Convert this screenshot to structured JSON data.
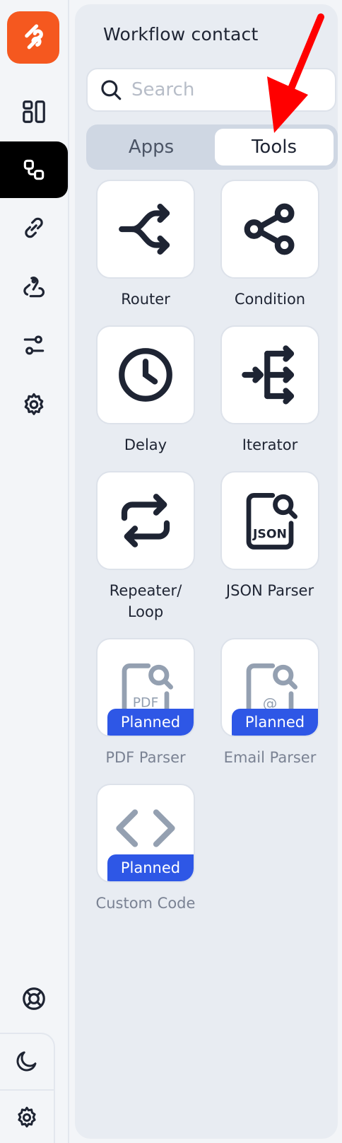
{
  "colors": {
    "brand": "#f5581f",
    "badge": "#2e57e6",
    "annotation": "#ff0000"
  },
  "sidebar": {
    "logo": "frontier-logo-icon",
    "items": [
      {
        "icon": "dashboard-icon"
      },
      {
        "icon": "workflow-icon",
        "active": true
      },
      {
        "icon": "link-icon"
      },
      {
        "icon": "webhook-icon"
      },
      {
        "icon": "sliders-icon"
      },
      {
        "icon": "gear-icon"
      }
    ],
    "bottom": [
      {
        "icon": "lifebuoy-icon"
      },
      {
        "icon": "moon-icon"
      },
      {
        "icon": "gear-icon"
      }
    ]
  },
  "panel": {
    "title": "Workflow contact",
    "search": {
      "placeholder": "Search",
      "value": ""
    },
    "tabs": [
      {
        "label": "Apps",
        "selected": false
      },
      {
        "label": "Tools",
        "selected": true
      }
    ],
    "tools": [
      {
        "label": "Router",
        "icon": "router-icon",
        "planned": false
      },
      {
        "label": "Condition",
        "icon": "condition-icon",
        "planned": false
      },
      {
        "label": "Delay",
        "icon": "clock-icon",
        "planned": false
      },
      {
        "label": "Iterator",
        "icon": "iterator-icon",
        "planned": false
      },
      {
        "label": "Repeater/ Loop",
        "icon": "repeat-icon",
        "planned": false
      },
      {
        "label": "JSON Parser",
        "icon": "json-file-icon",
        "icon_text": "JSON",
        "planned": false
      },
      {
        "label": "PDF Parser",
        "icon": "pdf-file-icon",
        "icon_text": "PDF",
        "planned": true,
        "badge": "Planned"
      },
      {
        "label": "Email Parser",
        "icon": "email-file-icon",
        "icon_text": "@",
        "planned": true,
        "badge": "Planned"
      },
      {
        "label": "Custom Code",
        "icon": "code-icon",
        "planned": true,
        "badge": "Planned"
      }
    ]
  }
}
